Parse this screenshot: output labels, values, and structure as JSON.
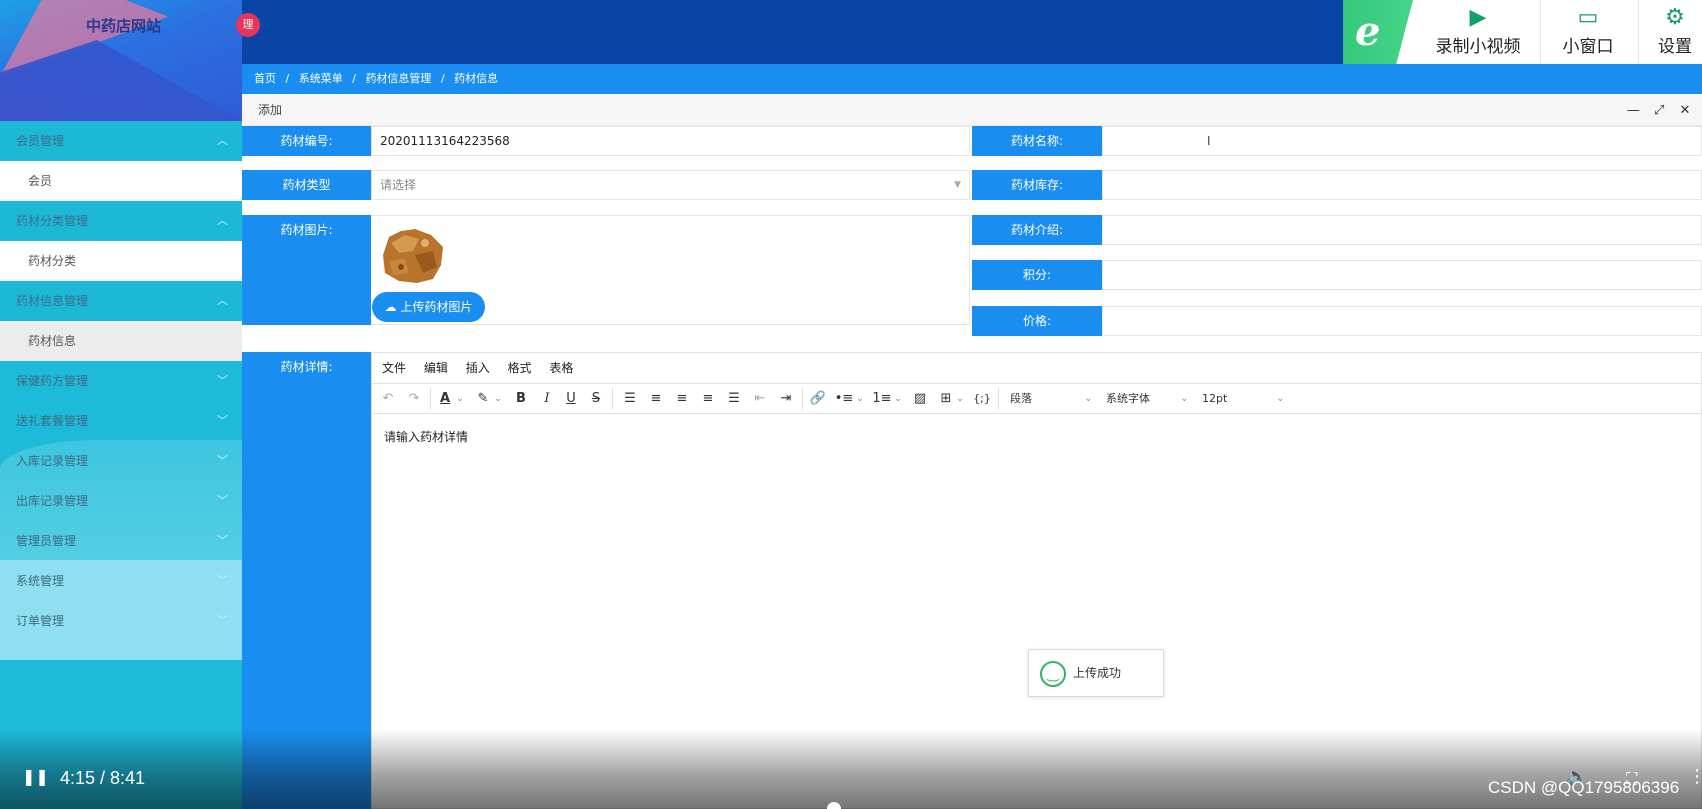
{
  "app": {
    "title": "中药店网站",
    "badge": "理"
  },
  "sidebar": {
    "groups": [
      {
        "label": "会员管理",
        "open": true,
        "items": [
          {
            "label": "会员"
          }
        ]
      },
      {
        "label": "药材分类管理",
        "open": true,
        "items": [
          {
            "label": "药材分类"
          }
        ]
      },
      {
        "label": "药材信息管理",
        "open": true,
        "items": [
          {
            "label": "药材信息"
          }
        ]
      },
      {
        "label": "保健药方管理"
      },
      {
        "label": "送礼套餐管理"
      },
      {
        "label": "入库记录管理"
      },
      {
        "label": "出库记录管理"
      },
      {
        "label": "管理员管理"
      },
      {
        "label": "系统管理"
      },
      {
        "label": "订单管理"
      }
    ]
  },
  "video_tools": {
    "record": "录制小视频",
    "window": "小窗口",
    "settings": "设置"
  },
  "breadcrumb": [
    "首页",
    "/",
    "系统菜单",
    "/",
    "药材信息管理",
    "/",
    "药材信息"
  ],
  "dialog": {
    "title": "添加"
  },
  "form": {
    "code_label": "药材编号:",
    "code_value": "20201113164223568",
    "name_label": "药材名称:",
    "type_label": "药材类型",
    "type_placeholder": "请选择",
    "stock_label": "药材库存:",
    "image_label": "药材图片:",
    "intro_label": "药材介绍:",
    "points_label": "积分:",
    "price_label": "价格:",
    "upload_label": "上传药材图片",
    "detail_label": "药材详情:"
  },
  "editor": {
    "menus": [
      "文件",
      "编辑",
      "插入",
      "格式",
      "表格"
    ],
    "block_format": "段落",
    "font_family": "系统字体",
    "font_size": "12pt",
    "placeholder": "请输入药材详情"
  },
  "toast": {
    "message": "上传成功"
  },
  "video": {
    "time": "4:15 / 8:41",
    "progress": 0.49,
    "watermark": "CSDN @QQ1795806396"
  }
}
